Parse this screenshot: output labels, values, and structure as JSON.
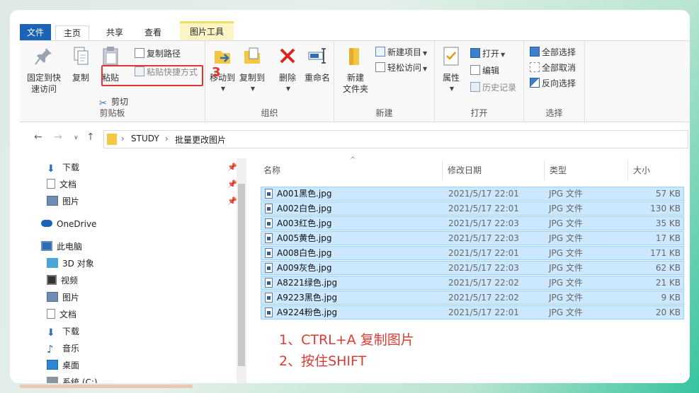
{
  "tabs": {
    "file": "文件",
    "home": "主页",
    "share": "共享",
    "view": "查看",
    "context": "图片工具"
  },
  "ribbon": {
    "clipboard": {
      "label": "剪贴板",
      "pin_line1": "固定到快",
      "pin_line2": "速访问",
      "copy": "复制",
      "paste": "粘贴",
      "copy_path": "复制路径",
      "paste_shortcut": "粘贴快捷方式",
      "cut": "剪切"
    },
    "organize": {
      "label": "组织",
      "move_to": "移动到",
      "copy_to": "复制到",
      "delete": "删除",
      "rename": "重命名"
    },
    "new": {
      "label": "新建",
      "new_folder_line1": "新建",
      "new_folder_line2": "文件夹",
      "new_item": "新建项目",
      "easy_access": "轻松访问"
    },
    "open": {
      "label": "打开",
      "properties": "属性",
      "open": "打开",
      "edit": "编辑",
      "history": "历史记录"
    },
    "select": {
      "label": "选择",
      "select_all": "全部选择",
      "select_none": "全部取消",
      "invert": "反向选择"
    }
  },
  "annotation_step": "3",
  "address": {
    "crumbs": [
      "STUDY",
      "批量更改图片"
    ]
  },
  "nav": {
    "quick": [
      "下载",
      "文档",
      "图片"
    ],
    "onedrive": "OneDrive",
    "pc": "此电脑",
    "pc_items": [
      "3D 对象",
      "视频",
      "图片",
      "文档",
      "下载",
      "音乐",
      "桌面",
      "系统 (C:)"
    ]
  },
  "columns": {
    "name": "名称",
    "date": "修改日期",
    "type": "类型",
    "size": "大小"
  },
  "files": [
    {
      "name": "A001黑色.jpg",
      "date": "2021/5/17 22:01",
      "type": "JPG 文件",
      "size": "57 KB"
    },
    {
      "name": "A002白色.jpg",
      "date": "2021/5/17 22:01",
      "type": "JPG 文件",
      "size": "130 KB"
    },
    {
      "name": "A003红色.jpg",
      "date": "2021/5/17 22:03",
      "type": "JPG 文件",
      "size": "35 KB"
    },
    {
      "name": "A005黄色.jpg",
      "date": "2021/5/17 22:03",
      "type": "JPG 文件",
      "size": "17 KB"
    },
    {
      "name": "A008白色.jpg",
      "date": "2021/5/17 22:01",
      "type": "JPG 文件",
      "size": "171 KB"
    },
    {
      "name": "A009灰色.jpg",
      "date": "2021/5/17 22:03",
      "type": "JPG 文件",
      "size": "62 KB"
    },
    {
      "name": "A8221绿色.jpg",
      "date": "2021/5/17 22:02",
      "type": "JPG 文件",
      "size": "21 KB"
    },
    {
      "name": "A9223黑色.jpg",
      "date": "2021/5/17 22:02",
      "type": "JPG 文件",
      "size": "9 KB"
    },
    {
      "name": "A9224粉色.jpg",
      "date": "2021/5/17 22:01",
      "type": "JPG 文件",
      "size": "20 KB"
    }
  ],
  "notes": [
    "1、CTRL+A 复制图片",
    "2、按住SHIFT"
  ],
  "colors": {
    "accent": "#1c63b5",
    "selection": "#cce8ff",
    "annotation": "#e3342f"
  }
}
